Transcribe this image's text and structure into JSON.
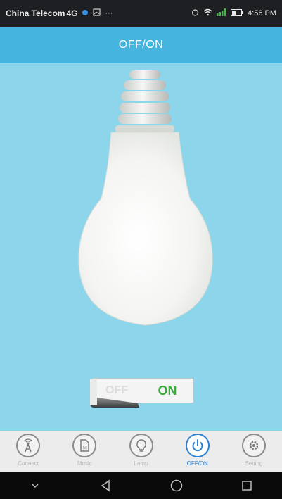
{
  "status_bar": {
    "carrier": "China Telecom",
    "network": "4G",
    "time": "4:56 PM"
  },
  "header": {
    "title": "OFF/ON"
  },
  "main": {
    "switch": {
      "off_label": "OFF",
      "on_label": "ON",
      "state": "on"
    }
  },
  "bottom_nav": {
    "items": [
      {
        "label": "Connect",
        "icon": "antenna-icon"
      },
      {
        "label": "Music",
        "icon": "music-file-icon"
      },
      {
        "label": "Lamp",
        "icon": "bulb-icon"
      },
      {
        "label": "OFF/ON",
        "icon": "power-icon",
        "active": true
      },
      {
        "label": "Setting",
        "icon": "gear-icon"
      }
    ]
  },
  "system_nav": {
    "buttons": [
      "down-chevron-icon",
      "back-icon",
      "home-icon",
      "recents-icon"
    ]
  },
  "colors": {
    "accent": "#45b4de",
    "background": "#8dd5ea",
    "active_nav": "#2d7fd0",
    "on_green": "#3daa3d"
  }
}
